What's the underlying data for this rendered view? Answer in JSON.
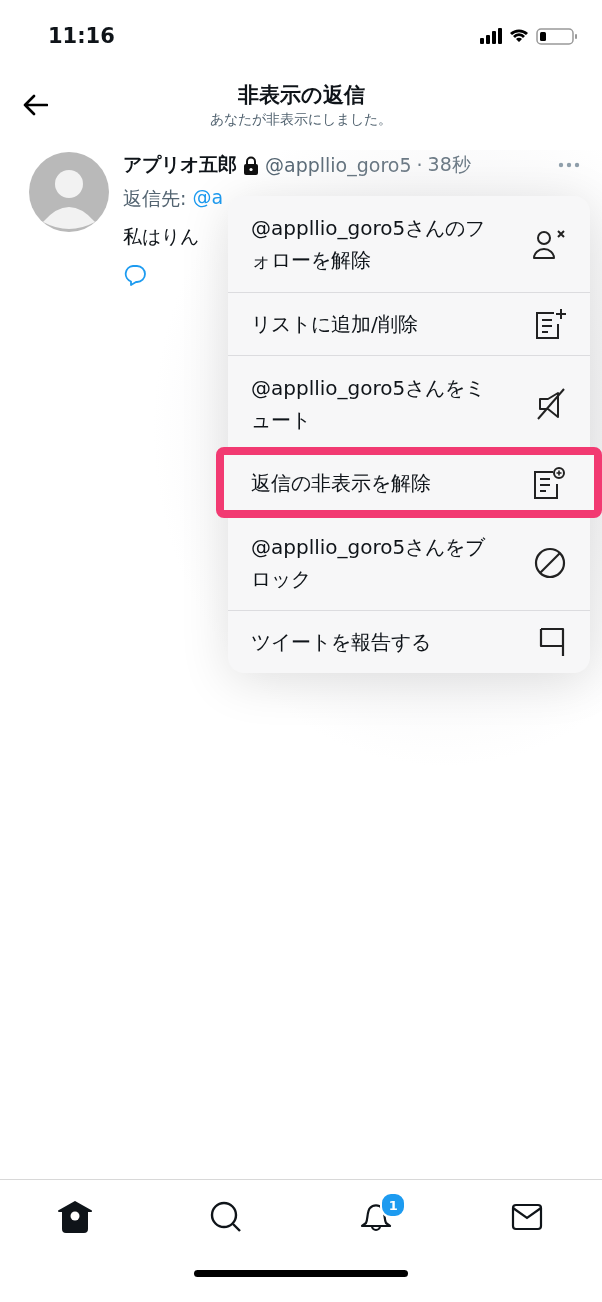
{
  "status_bar": {
    "time": "11:16"
  },
  "header": {
    "title": "非表示の返信",
    "subtitle": "あなたが非表示にしました。"
  },
  "tweet": {
    "name": "アプリオ五郎",
    "protected": true,
    "handle": "@appllio_goro5",
    "separator": "·",
    "time": "38秒",
    "reply_label": "返信先:",
    "reply_to": "@a",
    "text": "私はりん"
  },
  "menu": [
    {
      "kind": "unfollow",
      "label": "@appllio_goro5さんのフォローを解除",
      "selected": false
    },
    {
      "kind": "list",
      "label": "リストに追加/削除",
      "selected": false
    },
    {
      "kind": "mute",
      "label": "@appllio_goro5さんをミュート",
      "selected": false
    },
    {
      "kind": "unhide",
      "label": "返信の非表示を解除",
      "selected": true
    },
    {
      "kind": "block",
      "label": "@appllio_goro5さんをブロック",
      "selected": false
    },
    {
      "kind": "report",
      "label": "ツイートを報告する",
      "selected": false
    }
  ],
  "tab_bar": [
    {
      "kind": "home",
      "selected": true
    },
    {
      "kind": "search",
      "selected": false
    },
    {
      "kind": "notifications",
      "selected": false,
      "badge": "1"
    },
    {
      "kind": "messages",
      "selected": false
    }
  ]
}
